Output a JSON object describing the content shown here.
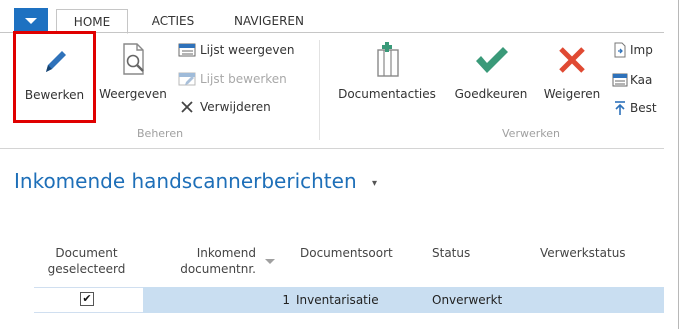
{
  "ribbon": {
    "tabs": [
      {
        "label": "HOME",
        "active": true
      },
      {
        "label": "ACTIES",
        "active": false
      },
      {
        "label": "NAVIGEREN",
        "active": false
      }
    ],
    "groups": {
      "beheren": {
        "label": "Beheren",
        "big_buttons": [
          {
            "label": "Bewerken",
            "icon": "pencil-icon",
            "highlighted": true
          },
          {
            "label": "Weergeven",
            "icon": "view-document-icon"
          }
        ],
        "small_buttons": [
          {
            "label": "Lijst weergeven",
            "icon": "list-view-icon",
            "enabled": true
          },
          {
            "label": "Lijst bewerken",
            "icon": "list-edit-icon",
            "enabled": false
          },
          {
            "label": "Verwijderen",
            "icon": "delete-x-icon",
            "enabled": true
          }
        ]
      },
      "verwerken": {
        "label": "Verwerken",
        "big_buttons": [
          {
            "label": "Documentacties",
            "icon": "document-actions-icon"
          },
          {
            "label": "Goedkeuren",
            "icon": "checkmark-icon"
          },
          {
            "label": "Weigeren",
            "icon": "reject-x-icon"
          }
        ],
        "small_buttons": [
          {
            "label": "Imp",
            "icon": "import-icon"
          },
          {
            "label": "Kaa",
            "icon": "card-icon"
          },
          {
            "label": "Best",
            "icon": "upload-arrow-icon"
          }
        ]
      }
    }
  },
  "page": {
    "title": "Inkomende handscannerberichten",
    "title_menu_icon": "title-dropdown-icon"
  },
  "table": {
    "columns": {
      "document_selected": "Document geselecteerd",
      "incoming_doc_no": "Inkomend documentnr.",
      "document_type": "Documentsoort",
      "status": "Status",
      "processing_status": "Verwerkstatus"
    },
    "rows": [
      {
        "selected": true,
        "incoming_doc_no": "1",
        "document_type": "Inventarisatie",
        "status": "Onverwerkt",
        "processing_status": ""
      }
    ]
  },
  "colors": {
    "accent": "#1e71c1",
    "title": "#1e6fb8",
    "highlight_border": "#e00000",
    "row_selected": "#c9def1",
    "approve_green": "#3a9a79",
    "reject_red": "#e04a33"
  }
}
